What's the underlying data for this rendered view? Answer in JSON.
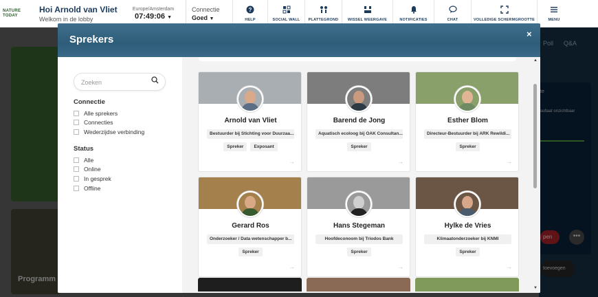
{
  "topbar": {
    "logo": [
      "NATURE",
      "TODAY"
    ],
    "greeting": "Hoi Arnold van Vliet",
    "subtitle": "Welkom in de lobby",
    "timezone": "Europe/Amsterdam",
    "time": "07:49:06",
    "connection_label": "Connectie",
    "connection_value": "Goed",
    "nav": [
      {
        "label": "HELP",
        "icon": "help-icon"
      },
      {
        "label": "SOCIAL WALL",
        "icon": "social-wall-icon"
      },
      {
        "label": "PLATTEGROND",
        "icon": "map-icon"
      },
      {
        "label": "WISSEL WEERGAVE",
        "icon": "switch-view-icon"
      },
      {
        "label": "NOTIFICATIES",
        "icon": "bell-icon"
      },
      {
        "label": "CHAT",
        "icon": "chat-icon"
      },
      {
        "label": "VOLLEDIGE SCHERMGROOTTE",
        "icon": "fullscreen-icon"
      },
      {
        "label": "MENU",
        "icon": "menu-icon"
      }
    ]
  },
  "background": {
    "programme_label": "Programm",
    "poll": "Poll",
    "qa": "Q&A",
    "panel_text1": "te",
    "panel_text2": "sultaat onzichtbaar",
    "red_button": "pen",
    "add_button": "toevoegen"
  },
  "modal": {
    "title": "Sprekers",
    "close": "×",
    "search_placeholder": "Zoeken",
    "filters": [
      {
        "title": "Connectie",
        "options": [
          "Alle sprekers",
          "Connecties",
          "Wederzijdse verbinding"
        ]
      },
      {
        "title": "Status",
        "options": [
          "Alle",
          "Online",
          "In gesprek",
          "Offline"
        ]
      }
    ],
    "speakers": [
      {
        "name": "Arnold van Vliet",
        "role": "Bestuurder bij Stichting voor Duurzaa...",
        "tags": [
          "Spreker",
          "Exposant"
        ],
        "cover": "#a9aeb3",
        "face": "#d9a98a",
        "body": "#5c6e86"
      },
      {
        "name": "Barend de Jong",
        "role": "Aquatisch ecoloog bij OAK Consultan...",
        "tags": [
          "Spreker"
        ],
        "cover": "#7d7d7d",
        "face": "#c99a7e",
        "body": "#2b3a44"
      },
      {
        "name": "Esther Blom",
        "role": "Directeur-Bestuurder bij ARK Rewildi...",
        "tags": [
          "Spreker"
        ],
        "cover": "#8aa06a",
        "face": "#e0b595",
        "body": "#6f8b64"
      },
      {
        "name": "Gerard Ros",
        "role": "Onderzoeker / Data wetenschapper b...",
        "tags": [
          "Spreker"
        ],
        "cover": "#a4804d",
        "face": "#d9a884",
        "body": "#355b2e"
      },
      {
        "name": "Hans Stegeman",
        "role": "Hoofdeconoom bij Triodos Bank",
        "tags": [
          "Spreker"
        ],
        "cover": "#9a9a9a",
        "face": "#cfcfcf",
        "body": "#222222"
      },
      {
        "name": "Hylke de Vries",
        "role": "Klimaatonderzoeker bij KNMI",
        "tags": [
          "Spreker"
        ],
        "cover": "#6b5544",
        "face": "#d8a688",
        "body": "#4a5b6d"
      }
    ]
  }
}
